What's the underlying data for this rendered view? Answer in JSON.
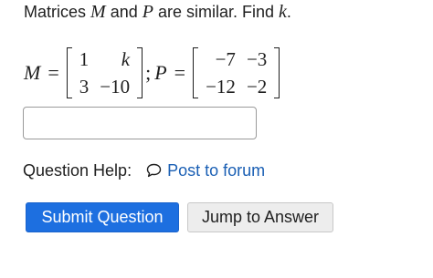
{
  "question": {
    "prompt_parts": [
      "Matrices ",
      "M",
      " and ",
      "P",
      " are similar. Find ",
      "k",
      "."
    ]
  },
  "equation": {
    "m_symbol": "M",
    "p_symbol": "P",
    "equals": "=",
    "separator": ";",
    "matrix_m": [
      [
        "1",
        "k"
      ],
      [
        "3",
        "−10"
      ]
    ],
    "matrix_p": [
      [
        "−7",
        "−3"
      ],
      [
        "−12",
        "−2"
      ]
    ]
  },
  "answer": {
    "value": "",
    "placeholder": ""
  },
  "help": {
    "label": "Question Help:",
    "forum_link": "Post to forum",
    "forum_icon": "speech-bubble-icon"
  },
  "buttons": {
    "submit": "Submit Question",
    "jump": "Jump to Answer"
  },
  "colors": {
    "primary": "#1d6fe0",
    "link": "#1a5fb4",
    "secondary_bg": "#ededed"
  }
}
